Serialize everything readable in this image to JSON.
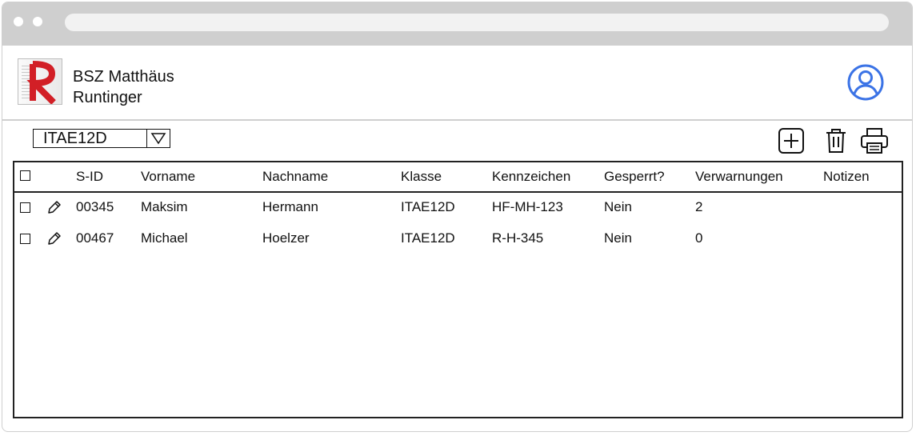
{
  "header": {
    "school_line1": "BSZ Matthäus",
    "school_line2": "Runtinger",
    "logo_icon": "runtinger-r-logo-icon",
    "user_icon": "user-profile-icon"
  },
  "toolbar": {
    "class_select_value": "ITAE12D",
    "add_icon": "plus-square-icon",
    "delete_icon": "trash-icon",
    "print_icon": "printer-icon"
  },
  "table": {
    "columns": [
      "S-ID",
      "Vorname",
      "Nachname",
      "Klasse",
      "Kennzeichen",
      "Gesperrt?",
      "Verwarnungen",
      "Notizen"
    ],
    "rows": [
      [
        "00345",
        "Maksim",
        "Hermann",
        "ITAE12D",
        "HF-MH-123",
        "Nein",
        "2",
        ""
      ],
      [
        "00467",
        "Michael",
        "Hoelzer",
        "ITAE12D",
        "R-H-345",
        "Nein",
        "0",
        ""
      ]
    ]
  },
  "colors": {
    "chrome": "#cfcfcf",
    "user_icon": "#3b73e6",
    "logo_red": "#d21f26"
  }
}
